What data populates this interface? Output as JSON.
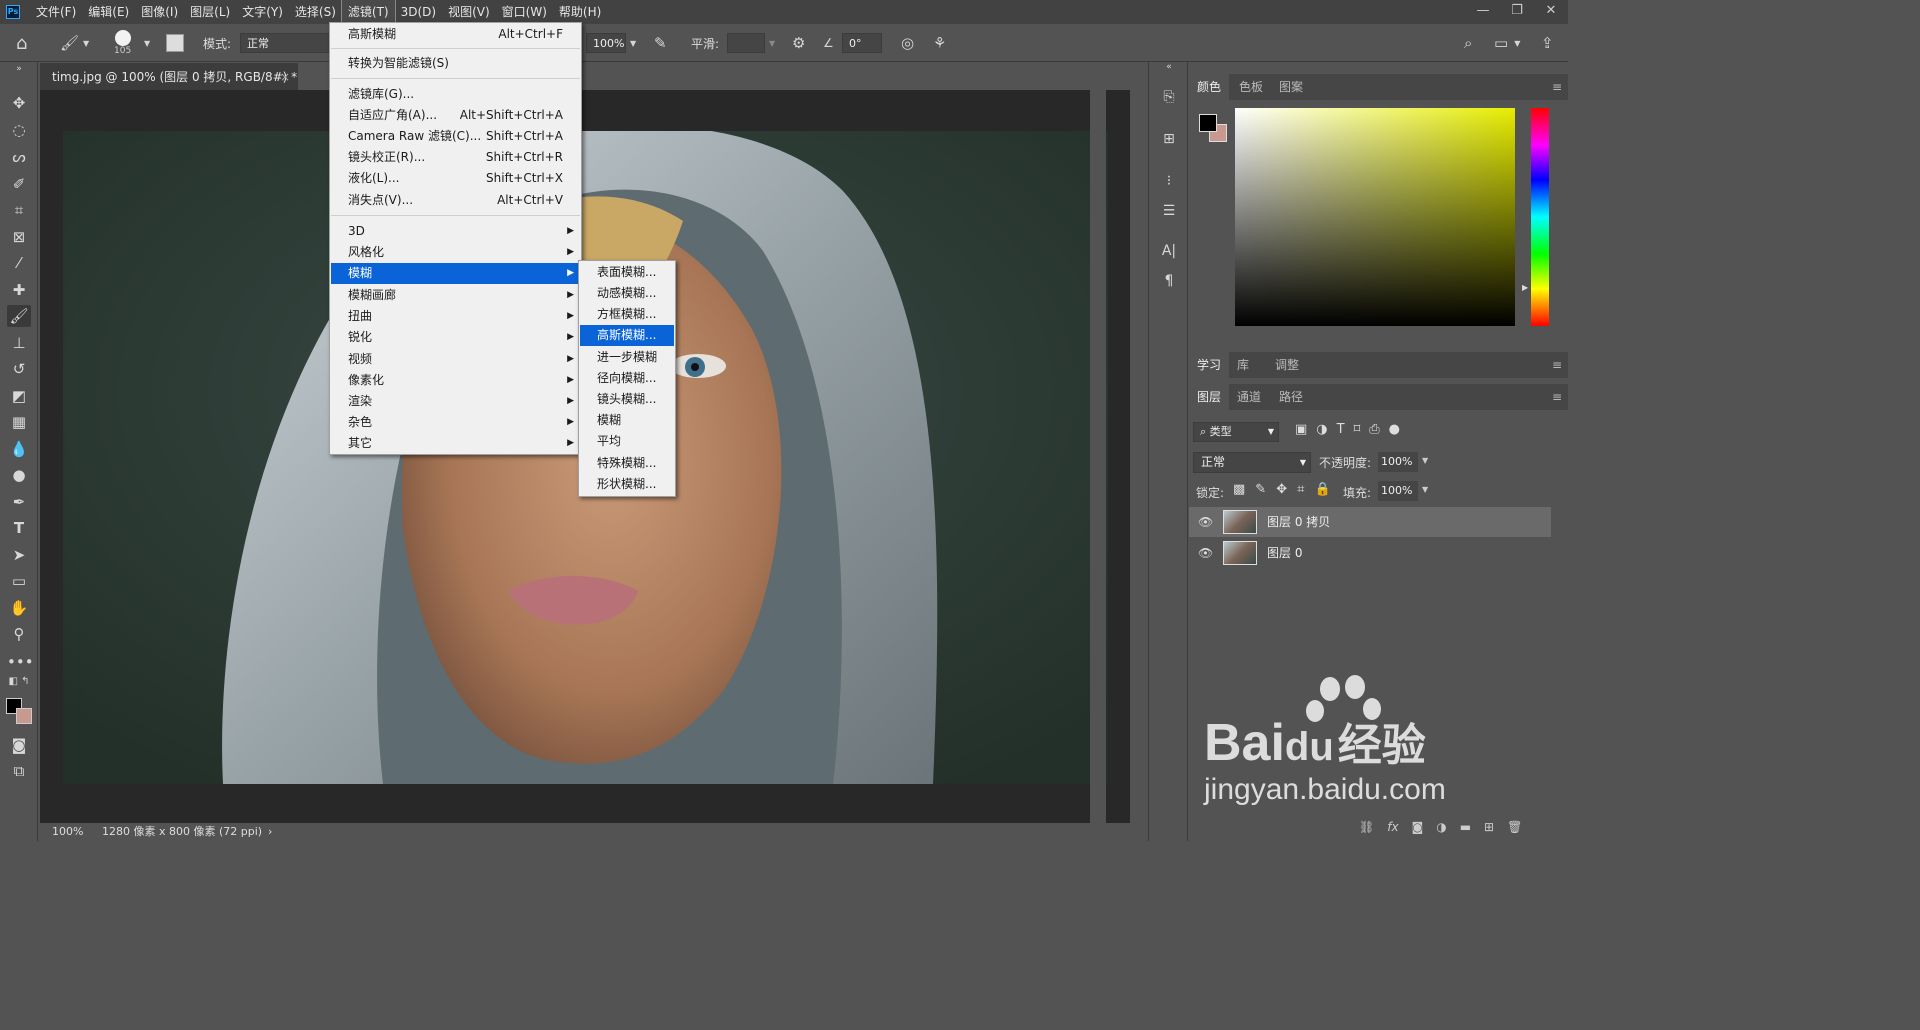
{
  "app": {
    "logo": "Ps"
  },
  "menubar": {
    "items": [
      "文件(F)",
      "编辑(E)",
      "图像(I)",
      "图层(L)",
      "文字(Y)",
      "选择(S)",
      "滤镜(T)",
      "3D(D)",
      "视图(V)",
      "窗口(W)",
      "帮助(H)"
    ],
    "active_index": 6
  },
  "window_controls": {
    "minimize": "—",
    "restore": "❐",
    "close": "✕"
  },
  "options": {
    "brush_size": "105",
    "mode_label": "模式:",
    "mode_value": "正常",
    "flow_value": "100%",
    "smooth_label": "平滑:",
    "angle_value": "0°"
  },
  "document": {
    "tab_title": "timg.jpg @ 100% (图层 0 拷贝, RGB/8#) *",
    "tab_close": "×",
    "zoom": "100%",
    "info": "1280 像素 x 800 像素 (72 ppi)",
    "info_arrow": "›"
  },
  "filter_menu": {
    "items": [
      {
        "label": "高斯模糊",
        "shortcut": "Alt+Ctrl+F"
      },
      {
        "label": "转换为智能滤镜(S)",
        "shortcut": ""
      },
      {
        "label": "滤镜库(G)...",
        "shortcut": ""
      },
      {
        "label": "自适应广角(A)...",
        "shortcut": "Alt+Shift+Ctrl+A"
      },
      {
        "label": "Camera Raw 滤镜(C)...",
        "shortcut": "Shift+Ctrl+A"
      },
      {
        "label": "镜头校正(R)...",
        "shortcut": "Shift+Ctrl+R"
      },
      {
        "label": "液化(L)...",
        "shortcut": "Shift+Ctrl+X"
      },
      {
        "label": "消失点(V)...",
        "shortcut": "Alt+Ctrl+V"
      },
      {
        "label": "3D",
        "submenu": true
      },
      {
        "label": "风格化",
        "submenu": true
      },
      {
        "label": "模糊",
        "submenu": true,
        "highlighted": true
      },
      {
        "label": "模糊画廊",
        "submenu": true
      },
      {
        "label": "扭曲",
        "submenu": true
      },
      {
        "label": "锐化",
        "submenu": true
      },
      {
        "label": "视频",
        "submenu": true
      },
      {
        "label": "像素化",
        "submenu": true
      },
      {
        "label": "渲染",
        "submenu": true
      },
      {
        "label": "杂色",
        "submenu": true
      },
      {
        "label": "其它",
        "submenu": true
      }
    ]
  },
  "blur_submenu": {
    "items": [
      "表面模糊...",
      "动感模糊...",
      "方框模糊...",
      "高斯模糊...",
      "进一步模糊",
      "径向模糊...",
      "镜头模糊...",
      "模糊",
      "平均",
      "特殊模糊...",
      "形状模糊..."
    ],
    "highlighted_index": 3
  },
  "color_panel": {
    "tabs": [
      "颜色",
      "色板",
      "图案"
    ],
    "foreground": "#000000",
    "background": "#c89a8f",
    "field_hue": "#e7ed00"
  },
  "learn_panel": {
    "tabs": [
      "学习",
      "库",
      "调整"
    ]
  },
  "layers_panel": {
    "tabs": [
      "图层",
      "通道",
      "路径"
    ],
    "filter_kind": "类型",
    "blend_mode": "正常",
    "opacity_label": "不透明度:",
    "opacity_value": "100%",
    "lock_label": "锁定:",
    "fill_label": "填充:",
    "fill_value": "100%",
    "layers": [
      {
        "name": "图层 0 拷贝",
        "visible": true,
        "selected": true
      },
      {
        "name": "图层 0",
        "visible": true,
        "selected": false
      }
    ]
  },
  "watermark": {
    "brand": "Bai",
    "brand2": "du",
    "cn": "经验",
    "url": "jingyan.baidu.com"
  }
}
